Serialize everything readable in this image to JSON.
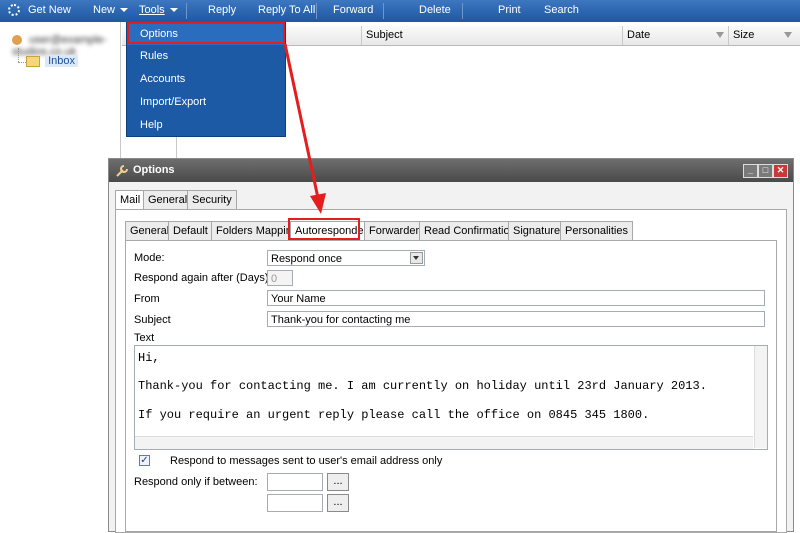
{
  "toolbar": {
    "get_new": "Get New",
    "new": "New",
    "tools": "Tools",
    "reply": "Reply",
    "reply_all": "Reply To All",
    "forward": "Forward",
    "delete": "Delete",
    "print": "Print",
    "search": "Search"
  },
  "tree": {
    "account": "user@example-studios.co.uk",
    "inbox": "Inbox"
  },
  "list_columns": {
    "subject": "Subject",
    "date": "Date",
    "size": "Size"
  },
  "tools_menu": {
    "items": [
      "Options",
      "Rules",
      "Accounts",
      "Import/Export",
      "Help"
    ]
  },
  "options_window": {
    "title": "Options",
    "top_tabs": [
      "Mail",
      "General",
      "Security"
    ],
    "sub_tabs": [
      "General",
      "Default",
      "Folders Mapping",
      "Autoresponder",
      "Forwarder",
      "Read Confirmation",
      "Signature",
      "Personalities"
    ],
    "form": {
      "mode_label": "Mode:",
      "mode_value": "Respond once",
      "respond_again_label": "Respond again after (Days):",
      "respond_again_value": "0",
      "from_label": "From",
      "from_value": "Your Name",
      "subject_label": "Subject",
      "subject_value": "Thank-you for contacting me",
      "text_label": "Text",
      "text_line1": "Hi,",
      "text_line2": "Thank-you for contacting me. I am currently on holiday until 23rd January 2013.",
      "text_line3": "If you require an urgent reply please call the office on 0845 345 1800.",
      "checkbox_label": "Respond to messages sent to user's email address only",
      "between_label": "Respond only if between:",
      "ellipsis": "..."
    }
  },
  "colors": {
    "toolbar": "#2a63ad",
    "menu": "#1c5aa6",
    "highlight": "#e41e1e"
  }
}
